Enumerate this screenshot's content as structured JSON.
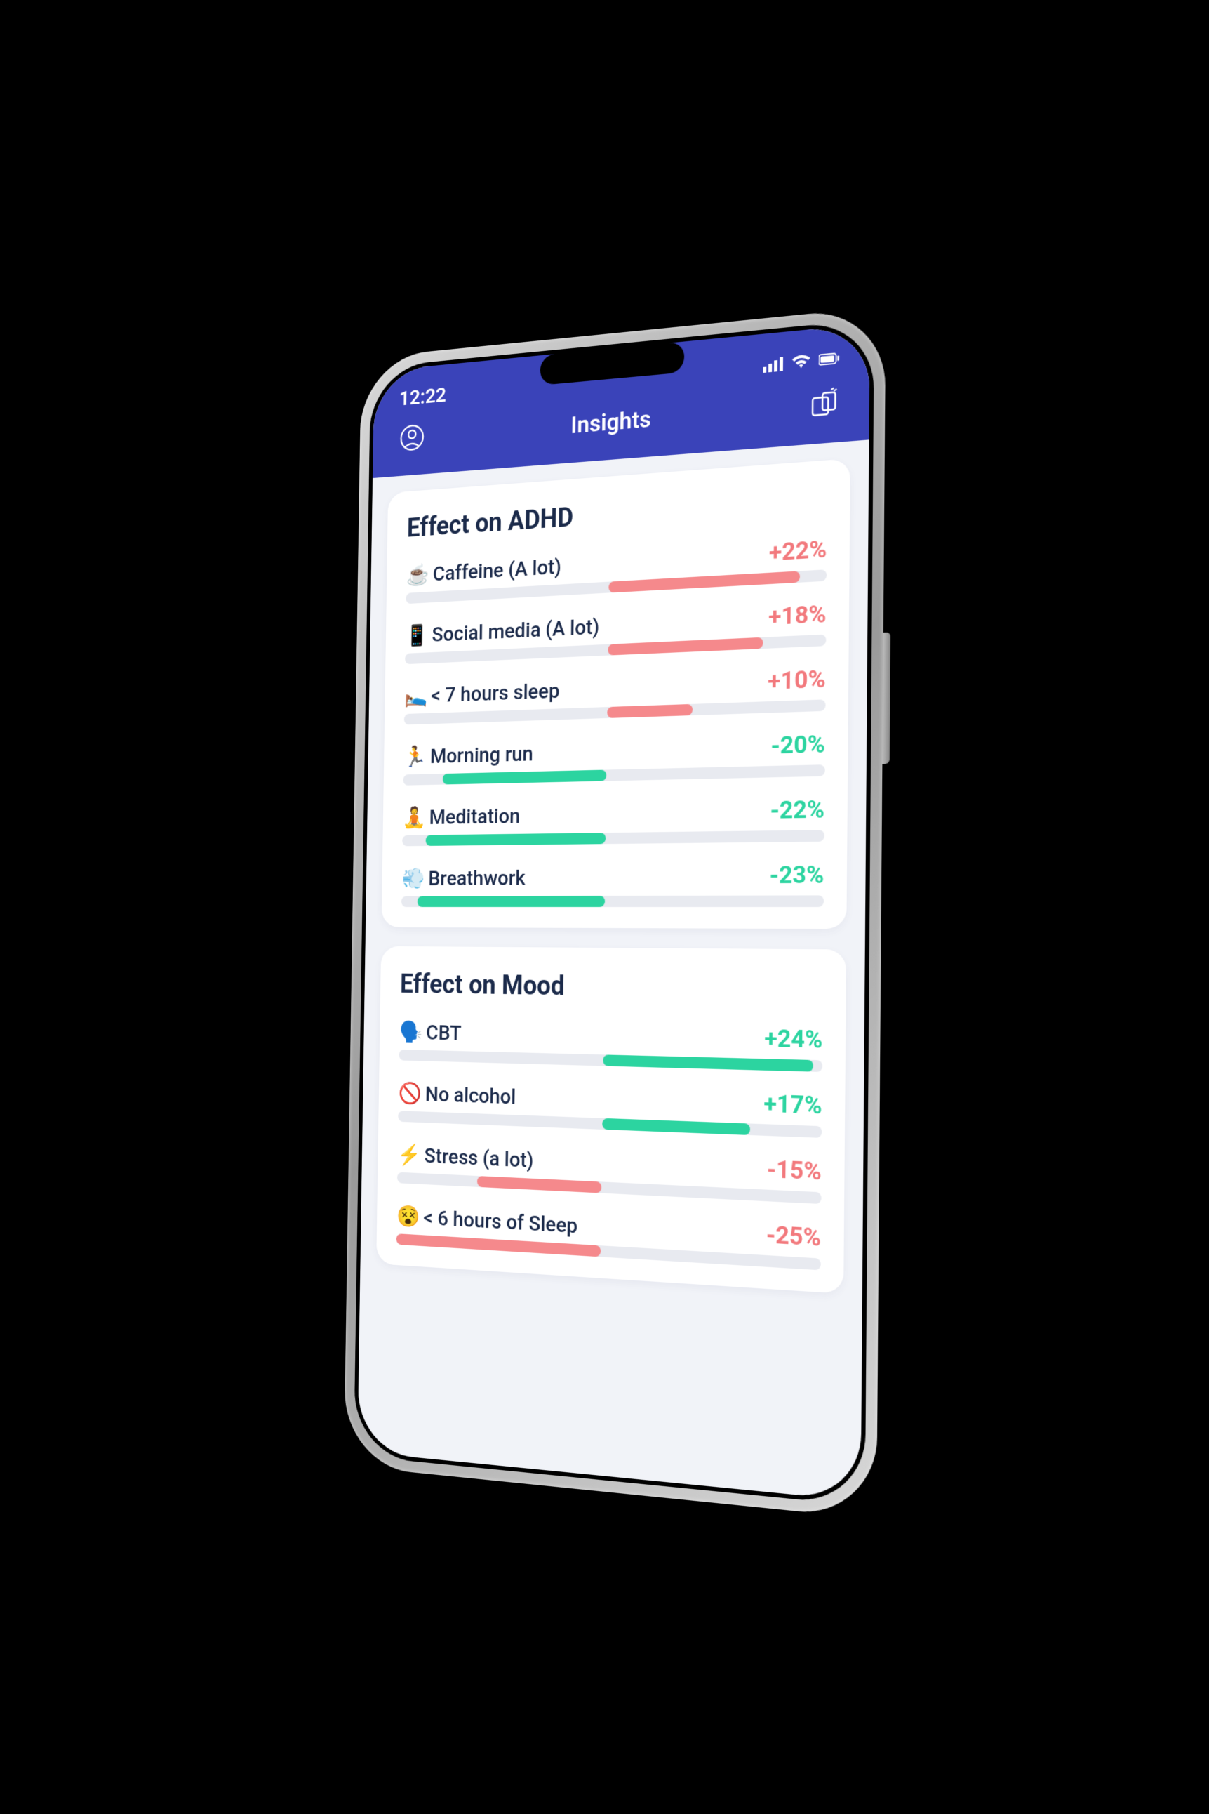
{
  "status": {
    "time": "12:22"
  },
  "header": {
    "title": "Insights"
  },
  "colors": {
    "positive_red": "#f5898c",
    "negative_green": "#2cd4a0",
    "track": "#e8eaf0",
    "header_bg": "#3a43b9",
    "text": "#1b2a4a"
  },
  "cards": [
    {
      "title": "Effect on ADHD",
      "items": [
        {
          "icon": "☕",
          "label": "Caffeine (A lot)",
          "value": "+22%",
          "tone": "red",
          "bar_start": 50,
          "bar_end": 94
        },
        {
          "icon": "📱",
          "label": "Social media (A lot)",
          "value": "+18%",
          "tone": "red",
          "bar_start": 50,
          "bar_end": 86
        },
        {
          "icon": "🛌",
          "label": "< 7 hours sleep",
          "value": "+10%",
          "tone": "red",
          "bar_start": 50,
          "bar_end": 70
        },
        {
          "icon": "🏃",
          "label": "Morning run",
          "value": "-20%",
          "tone": "green",
          "bar_start": 10,
          "bar_end": 50
        },
        {
          "icon": "🧘",
          "label": "Meditation",
          "value": "-22%",
          "tone": "green",
          "bar_start": 6,
          "bar_end": 50
        },
        {
          "icon": "💨",
          "label": "Breathwork",
          "value": "-23%",
          "tone": "green",
          "bar_start": 4,
          "bar_end": 50
        }
      ]
    },
    {
      "title": "Effect on Mood",
      "items": [
        {
          "icon": "🗣️",
          "label": "CBT",
          "value": "+24%",
          "tone": "green",
          "bar_start": 50,
          "bar_end": 98
        },
        {
          "icon": "🚫",
          "label": "No alcohol",
          "value": "+17%",
          "tone": "green",
          "bar_start": 50,
          "bar_end": 84
        },
        {
          "icon": "⚡",
          "label": "Stress (a lot)",
          "value": "-15%",
          "tone": "red",
          "bar_start": 20,
          "bar_end": 50
        },
        {
          "icon": "😵",
          "label": "< 6 hours of Sleep",
          "value": "-25%",
          "tone": "red",
          "bar_start": 0,
          "bar_end": 50
        }
      ]
    }
  ]
}
